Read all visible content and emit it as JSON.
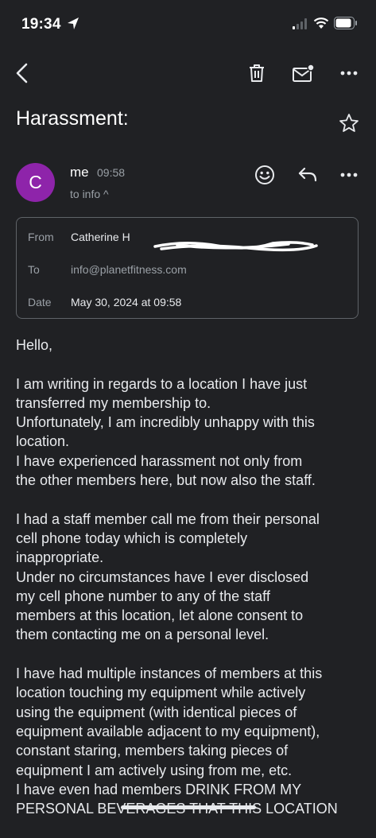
{
  "status_bar": {
    "time": "19:34"
  },
  "toolbar": {
    "back_icon": "chevron-left-icon",
    "delete_icon": "trash-icon",
    "mark_unread_icon": "mail-unread-icon",
    "more_icon": "more-horizontal-icon"
  },
  "email": {
    "subject": "Harassment:",
    "avatar_letter": "C",
    "sender": "me",
    "time": "09:58",
    "to_summary": "to info ^",
    "details": {
      "from_label": "From",
      "from_value": "Catherine H",
      "to_label": "To",
      "to_value": "info@planetfitness.com",
      "date_label": "Date",
      "date_value": "May 30, 2024 at 09:58"
    },
    "body": {
      "greeting": "Hello,",
      "p1": [
        "I am writing in regards to a location I have just",
        "transferred my membership to.",
        "Unfortunately, I am incredibly unhappy with this",
        "location.",
        "I have experienced harassment not only from",
        "the other members here, but now also the staff."
      ],
      "p2": [
        "I had a staff member call me from their personal",
        "cell phone today which is completely",
        "inappropriate.",
        "Under no circumstances have I ever disclosed",
        "my cell phone number to any of the staff",
        "members at this location, let alone consent to",
        "them contacting me on a personal level."
      ],
      "p3": [
        "I have had multiple instances of members at this",
        "location touching my equipment while actively",
        "using the equipment (with identical pieces of",
        "equipment available adjacent to my equipment),",
        "constant staring, members taking pieces of",
        "equipment I am actively using from me, etc.",
        "I have even had members DRINK FROM MY",
        "PERSONAL BEVERAGES THAT THIS LOCATION"
      ]
    }
  },
  "colors": {
    "background": "#202124",
    "avatar": "#8e24aa",
    "text": "#e8eaed",
    "muted": "#9aa0a6"
  }
}
